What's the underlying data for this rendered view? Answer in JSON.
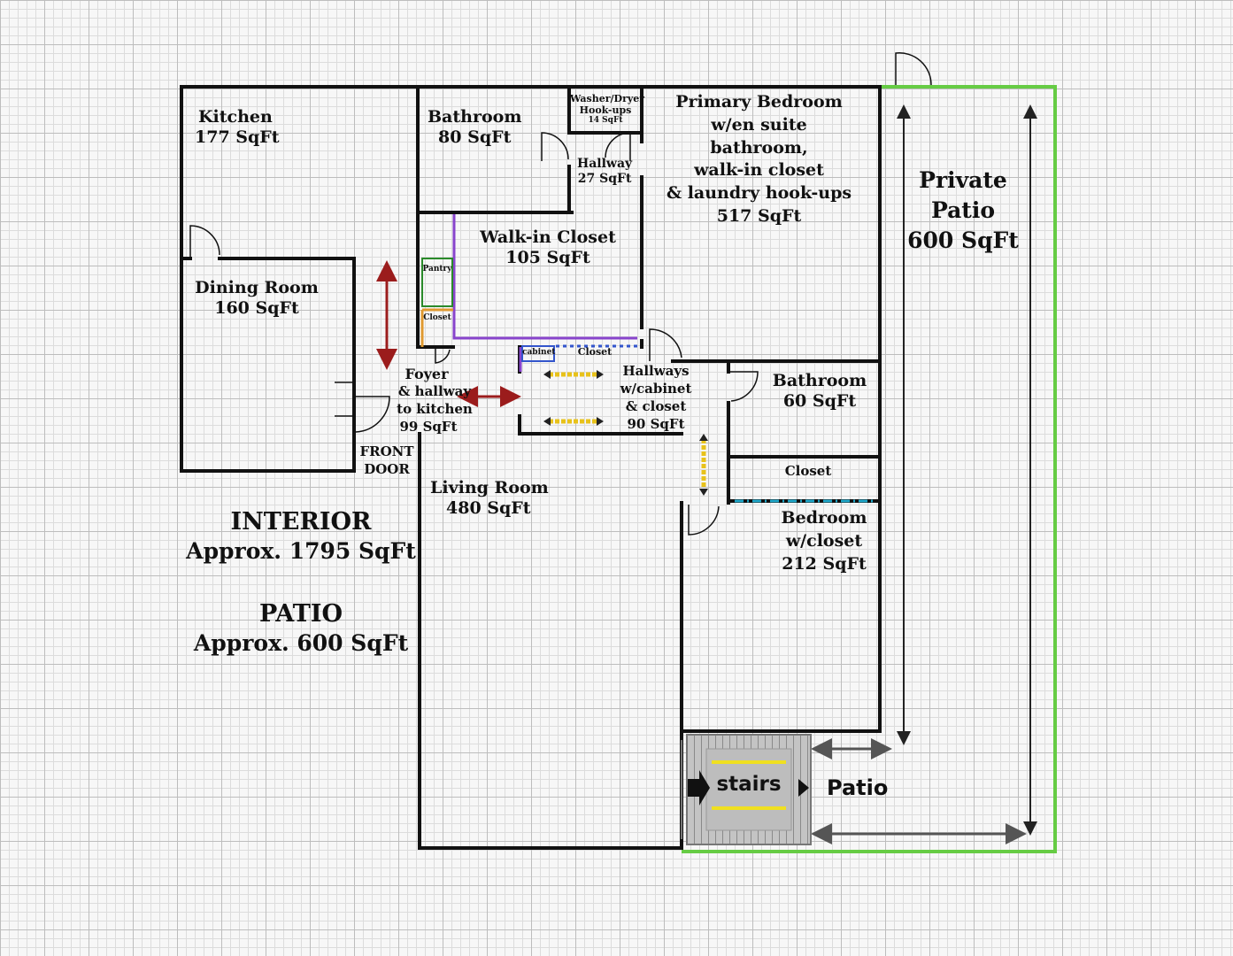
{
  "rooms": {
    "kitchen": {
      "name": "Kitchen",
      "area": "177 SqFt"
    },
    "bathroom1": {
      "name": "Bathroom",
      "area": "80 SqFt"
    },
    "washer": {
      "name": "Washer/Dryer Hook-ups",
      "area": "14 SqFt"
    },
    "hallway1": {
      "name": "Hallway",
      "area": "27 SqFt"
    },
    "primary": {
      "lines": [
        "Primary Bedroom",
        "w/en suite",
        "bathroom,",
        "walk-in closet",
        "& laundry hook-ups"
      ],
      "area": "517 SqFt"
    },
    "walkin": {
      "name": "Walk-in Closet",
      "area": "105 SqFt"
    },
    "pantry": {
      "name": "Pantry"
    },
    "closet_small": {
      "name": "Closet"
    },
    "dining": {
      "name": "Dining Room",
      "area": "160 SqFt"
    },
    "cabinet": {
      "name": "cabinet"
    },
    "closet_hall": {
      "name": "Closet"
    },
    "foyer": {
      "lines": [
        "Foyer",
        "& hallway",
        "to kitchen"
      ],
      "area": "99 SqFt"
    },
    "hallways": {
      "lines": [
        "Hallways",
        "w/cabinet",
        "& closet"
      ],
      "area": "90 SqFt"
    },
    "bathroom2": {
      "name": "Bathroom",
      "area": "60 SqFt"
    },
    "closet_bed": {
      "name": "Closet"
    },
    "bedroom": {
      "lines": [
        "Bedroom",
        "w/closet"
      ],
      "area": "212 SqFt"
    },
    "living": {
      "name": "Living Room",
      "area": "480 SqFt"
    },
    "front_door": {
      "lines": [
        "FRONT",
        "DOOR"
      ]
    },
    "stairs": {
      "name": "stairs"
    },
    "patio": {
      "name": "Patio"
    },
    "private_patio": {
      "lines": [
        "Private",
        "Patio"
      ],
      "area": "600 SqFt"
    }
  },
  "summary": {
    "interior_title": "INTERIOR",
    "interior_area": "Approx. 1795 SqFt",
    "patio_title": "PATIO",
    "patio_area": "Approx. 600 SqFt"
  },
  "colors": {
    "wall": "#111111",
    "patio_border": "#66cc44",
    "walkin_outline": "#8844cc",
    "pantry_outline": "#2a8a2a",
    "closet_outline": "#e09a30",
    "closet_dots": "#3355cc",
    "bedroom_closet_line": "#22aacc",
    "arrow_red": "#9b1c1c",
    "arrow_yellow": "#e8c21a",
    "arrow_gray": "#555555",
    "stairs_fill": "#b9b9b9"
  }
}
